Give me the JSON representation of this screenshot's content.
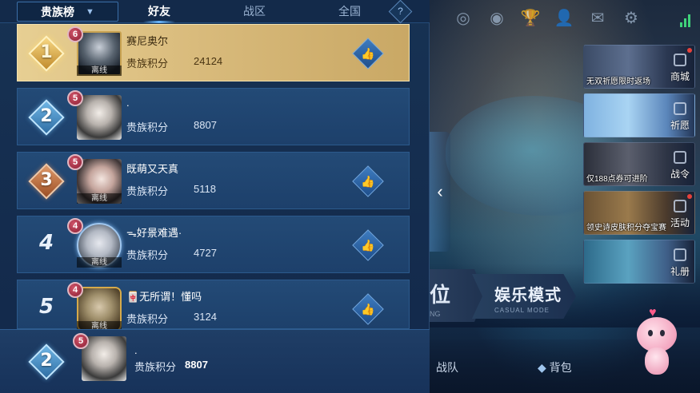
{
  "panel": {
    "dropdown_label": "贵族榜",
    "tabs": [
      "好友",
      "战区",
      "全国"
    ],
    "help_label": "?"
  },
  "ranking": [
    {
      "rank": "1",
      "level": "6",
      "name": "赛尼奥尔",
      "score_label": "贵族积分",
      "score": "24124",
      "status": "离线",
      "liked": true
    },
    {
      "rank": "2",
      "level": "5",
      "name": ".",
      "score_label": "贵族积分",
      "score": "8807",
      "status": "",
      "liked": false
    },
    {
      "rank": "3",
      "level": "5",
      "name": "既萌又天真",
      "score_label": "贵族积分",
      "score": "5118",
      "status": "离线",
      "liked": true
    },
    {
      "rank": "4",
      "level": "4",
      "name": "ᯓ好景难遇·",
      "score_label": "贵族积分",
      "score": "4727",
      "status": "离线",
      "liked": true
    },
    {
      "rank": "5",
      "level": "4",
      "name": "🀄无所谓！懂吗",
      "score_label": "贵族积分",
      "score": "3124",
      "status": "离线",
      "liked": true
    }
  ],
  "my_rank": {
    "rank": "2",
    "level": "5",
    "name": ".",
    "score_label": "贵族积分",
    "score": "8807"
  },
  "promos": [
    {
      "caption": "无双祈愿限时返场",
      "tag": "商城"
    },
    {
      "caption": "",
      "tag": "祈愿"
    },
    {
      "caption": "仅188点券可进阶",
      "tag": "战令"
    },
    {
      "caption": "领史诗皮肤积分夺宝赛",
      "tag": "活动"
    },
    {
      "caption": "",
      "tag": "礼册"
    }
  ],
  "modes": {
    "ranked_char": "位",
    "ranked_sub": "NG",
    "casual_title": "娱乐模式",
    "casual_sub": "CASUAL MODE"
  },
  "bottom": {
    "team": "战队",
    "bag": "背包"
  },
  "icons": {
    "like": "thumbs-up-icon",
    "top": [
      "target-icon",
      "eye-play-icon",
      "trophy-icon",
      "friends-icon",
      "mail-icon",
      "gear-icon"
    ]
  },
  "colors": {
    "gold_row": "#d9bb7c",
    "row_bg": "#1f436f",
    "accent": "#6ab8ff"
  }
}
